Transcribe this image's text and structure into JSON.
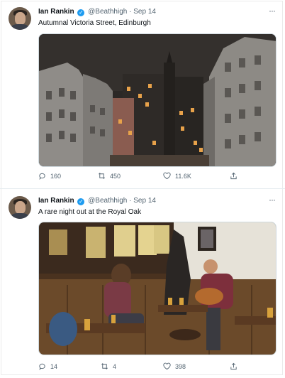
{
  "tweets": [
    {
      "author": "Ian Rankin",
      "handle": "@Beathhigh",
      "separator": "·",
      "date": "Sep 14",
      "text": "Autumnal Victoria Street, Edinburgh",
      "replies": "160",
      "retweets": "450",
      "likes": "11.6K"
    },
    {
      "author": "Ian Rankin",
      "handle": "@Beathhigh",
      "separator": "·",
      "date": "Sep 14",
      "text": "A rare night out at the Royal Oak",
      "replies": "14",
      "retweets": "4",
      "likes": "398"
    }
  ],
  "more_icon": "···",
  "colors": {
    "verified": "#1d9bf0",
    "muted": "#536471"
  }
}
